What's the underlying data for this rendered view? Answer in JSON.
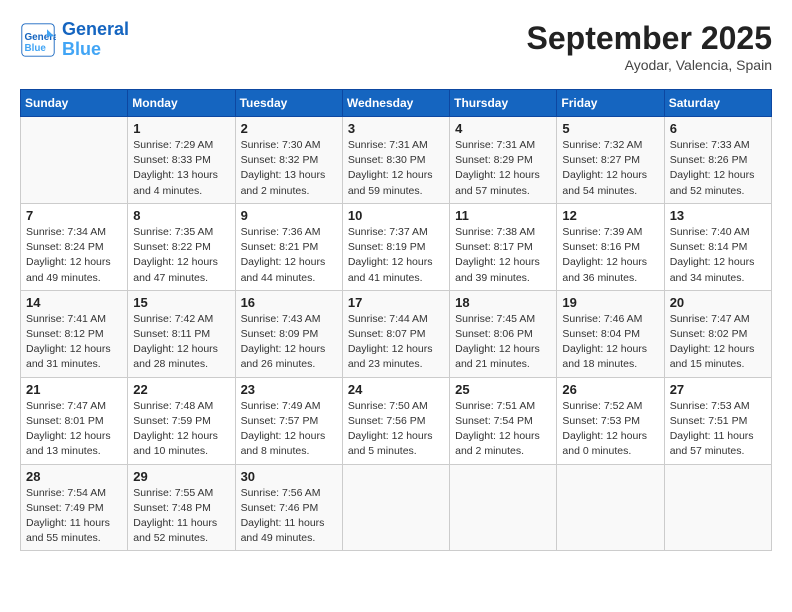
{
  "header": {
    "logo_line1": "General",
    "logo_line2": "Blue",
    "month_year": "September 2025",
    "location": "Ayodar, Valencia, Spain"
  },
  "days_of_week": [
    "Sunday",
    "Monday",
    "Tuesday",
    "Wednesday",
    "Thursday",
    "Friday",
    "Saturday"
  ],
  "weeks": [
    [
      {
        "day": "",
        "info": ""
      },
      {
        "day": "1",
        "info": "Sunrise: 7:29 AM\nSunset: 8:33 PM\nDaylight: 13 hours\nand 4 minutes."
      },
      {
        "day": "2",
        "info": "Sunrise: 7:30 AM\nSunset: 8:32 PM\nDaylight: 13 hours\nand 2 minutes."
      },
      {
        "day": "3",
        "info": "Sunrise: 7:31 AM\nSunset: 8:30 PM\nDaylight: 12 hours\nand 59 minutes."
      },
      {
        "day": "4",
        "info": "Sunrise: 7:31 AM\nSunset: 8:29 PM\nDaylight: 12 hours\nand 57 minutes."
      },
      {
        "day": "5",
        "info": "Sunrise: 7:32 AM\nSunset: 8:27 PM\nDaylight: 12 hours\nand 54 minutes."
      },
      {
        "day": "6",
        "info": "Sunrise: 7:33 AM\nSunset: 8:26 PM\nDaylight: 12 hours\nand 52 minutes."
      }
    ],
    [
      {
        "day": "7",
        "info": "Sunrise: 7:34 AM\nSunset: 8:24 PM\nDaylight: 12 hours\nand 49 minutes."
      },
      {
        "day": "8",
        "info": "Sunrise: 7:35 AM\nSunset: 8:22 PM\nDaylight: 12 hours\nand 47 minutes."
      },
      {
        "day": "9",
        "info": "Sunrise: 7:36 AM\nSunset: 8:21 PM\nDaylight: 12 hours\nand 44 minutes."
      },
      {
        "day": "10",
        "info": "Sunrise: 7:37 AM\nSunset: 8:19 PM\nDaylight: 12 hours\nand 41 minutes."
      },
      {
        "day": "11",
        "info": "Sunrise: 7:38 AM\nSunset: 8:17 PM\nDaylight: 12 hours\nand 39 minutes."
      },
      {
        "day": "12",
        "info": "Sunrise: 7:39 AM\nSunset: 8:16 PM\nDaylight: 12 hours\nand 36 minutes."
      },
      {
        "day": "13",
        "info": "Sunrise: 7:40 AM\nSunset: 8:14 PM\nDaylight: 12 hours\nand 34 minutes."
      }
    ],
    [
      {
        "day": "14",
        "info": "Sunrise: 7:41 AM\nSunset: 8:12 PM\nDaylight: 12 hours\nand 31 minutes."
      },
      {
        "day": "15",
        "info": "Sunrise: 7:42 AM\nSunset: 8:11 PM\nDaylight: 12 hours\nand 28 minutes."
      },
      {
        "day": "16",
        "info": "Sunrise: 7:43 AM\nSunset: 8:09 PM\nDaylight: 12 hours\nand 26 minutes."
      },
      {
        "day": "17",
        "info": "Sunrise: 7:44 AM\nSunset: 8:07 PM\nDaylight: 12 hours\nand 23 minutes."
      },
      {
        "day": "18",
        "info": "Sunrise: 7:45 AM\nSunset: 8:06 PM\nDaylight: 12 hours\nand 21 minutes."
      },
      {
        "day": "19",
        "info": "Sunrise: 7:46 AM\nSunset: 8:04 PM\nDaylight: 12 hours\nand 18 minutes."
      },
      {
        "day": "20",
        "info": "Sunrise: 7:47 AM\nSunset: 8:02 PM\nDaylight: 12 hours\nand 15 minutes."
      }
    ],
    [
      {
        "day": "21",
        "info": "Sunrise: 7:47 AM\nSunset: 8:01 PM\nDaylight: 12 hours\nand 13 minutes."
      },
      {
        "day": "22",
        "info": "Sunrise: 7:48 AM\nSunset: 7:59 PM\nDaylight: 12 hours\nand 10 minutes."
      },
      {
        "day": "23",
        "info": "Sunrise: 7:49 AM\nSunset: 7:57 PM\nDaylight: 12 hours\nand 8 minutes."
      },
      {
        "day": "24",
        "info": "Sunrise: 7:50 AM\nSunset: 7:56 PM\nDaylight: 12 hours\nand 5 minutes."
      },
      {
        "day": "25",
        "info": "Sunrise: 7:51 AM\nSunset: 7:54 PM\nDaylight: 12 hours\nand 2 minutes."
      },
      {
        "day": "26",
        "info": "Sunrise: 7:52 AM\nSunset: 7:53 PM\nDaylight: 12 hours\nand 0 minutes."
      },
      {
        "day": "27",
        "info": "Sunrise: 7:53 AM\nSunset: 7:51 PM\nDaylight: 11 hours\nand 57 minutes."
      }
    ],
    [
      {
        "day": "28",
        "info": "Sunrise: 7:54 AM\nSunset: 7:49 PM\nDaylight: 11 hours\nand 55 minutes."
      },
      {
        "day": "29",
        "info": "Sunrise: 7:55 AM\nSunset: 7:48 PM\nDaylight: 11 hours\nand 52 minutes."
      },
      {
        "day": "30",
        "info": "Sunrise: 7:56 AM\nSunset: 7:46 PM\nDaylight: 11 hours\nand 49 minutes."
      },
      {
        "day": "",
        "info": ""
      },
      {
        "day": "",
        "info": ""
      },
      {
        "day": "",
        "info": ""
      },
      {
        "day": "",
        "info": ""
      }
    ]
  ]
}
